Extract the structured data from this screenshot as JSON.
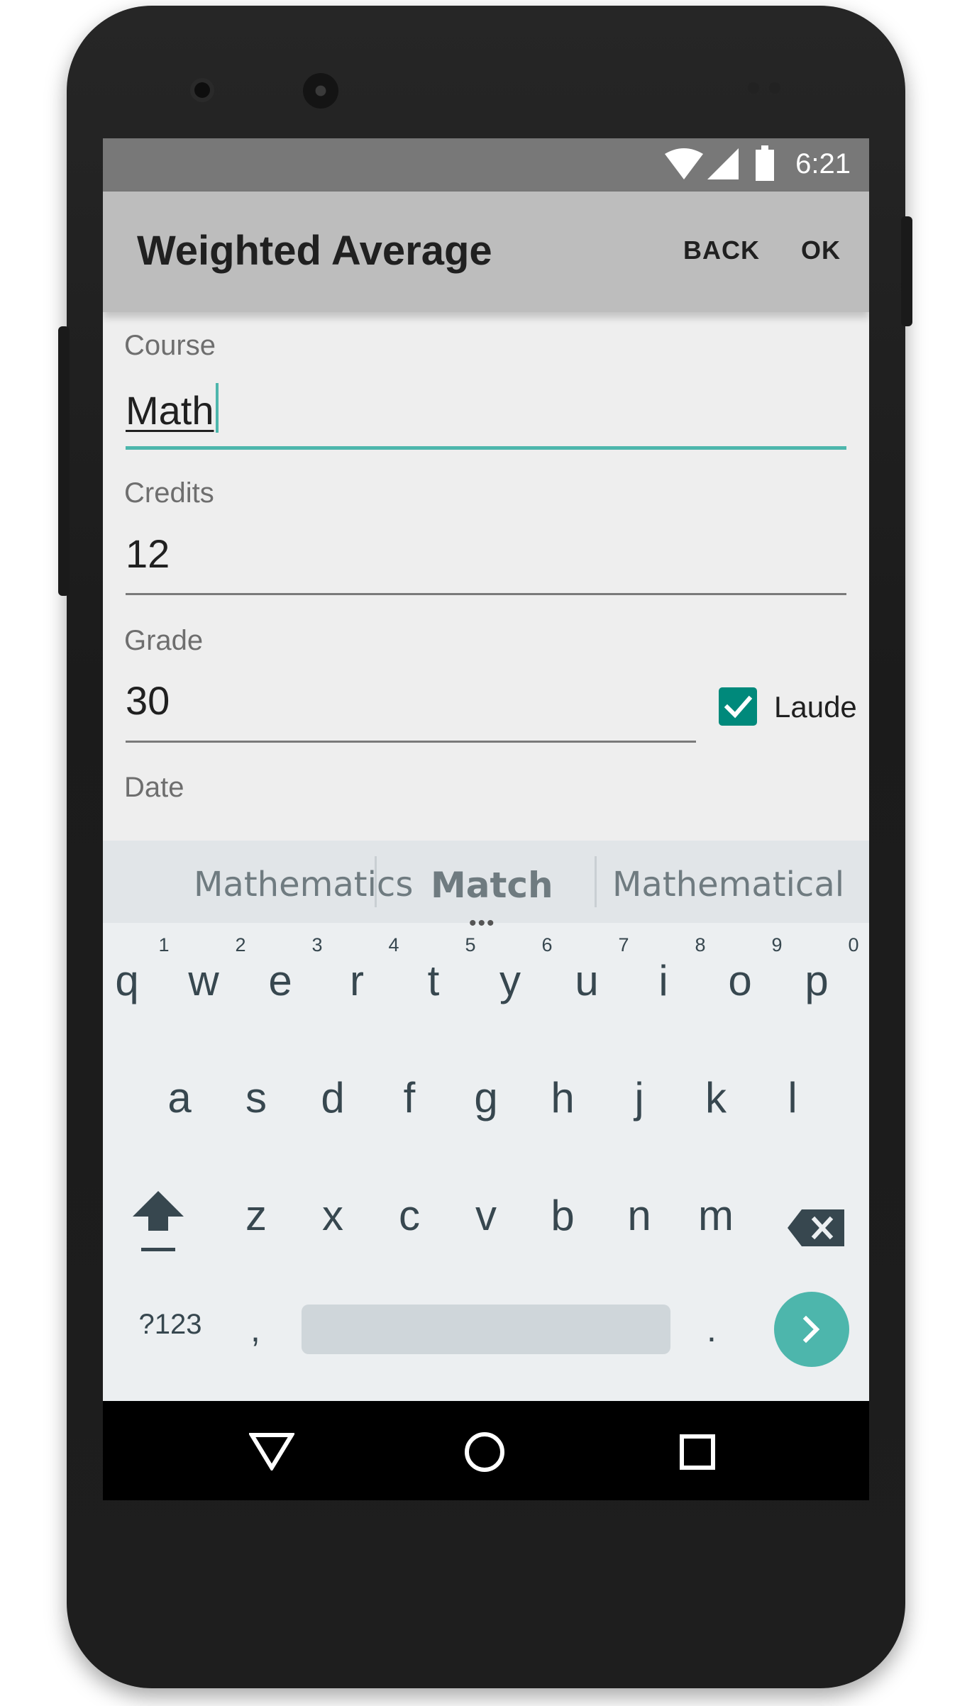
{
  "status_bar": {
    "time": "6:21",
    "icons": [
      "wifi-icon",
      "signal-icon",
      "battery-icon"
    ]
  },
  "app_bar": {
    "title": "Weighted Average",
    "back_label": "BACK",
    "ok_label": "OK"
  },
  "form": {
    "course": {
      "label": "Course",
      "value": "Math"
    },
    "credits": {
      "label": "Credits",
      "value": "12"
    },
    "grade": {
      "label": "Grade",
      "value": "30"
    },
    "laude": {
      "label": "Laude",
      "checked": true
    },
    "date": {
      "label": "Date"
    }
  },
  "keyboard": {
    "suggestions": [
      "Mathematics",
      "Match",
      "Mathematical"
    ],
    "row1": [
      "q",
      "w",
      "e",
      "r",
      "t",
      "y",
      "u",
      "i",
      "o",
      "p"
    ],
    "row1_hints": [
      "1",
      "2",
      "3",
      "4",
      "5",
      "6",
      "7",
      "8",
      "9",
      "0"
    ],
    "row2": [
      "a",
      "s",
      "d",
      "f",
      "g",
      "h",
      "j",
      "k",
      "l"
    ],
    "row3": [
      "z",
      "x",
      "c",
      "v",
      "b",
      "n",
      "m"
    ],
    "symbols_label": "?123",
    "comma": ",",
    "period": "."
  },
  "colors": {
    "accent": "#00897b",
    "accent_light": "#4db6ac",
    "app_bar": "#bdbdbd",
    "status_bar": "#787878"
  }
}
